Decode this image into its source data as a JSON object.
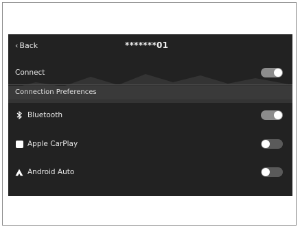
{
  "header": {
    "back_label": "Back",
    "title": "*******01"
  },
  "rows": {
    "connect": {
      "label": "Connect",
      "toggle": "on"
    },
    "section_header": "Connection Preferences",
    "bluetooth": {
      "label": "Bluetooth",
      "toggle": "on",
      "icon": "bluetooth-icon"
    },
    "carplay": {
      "label": "Apple CarPlay",
      "toggle": "off",
      "icon": "carplay-icon"
    },
    "android": {
      "label": "Android Auto",
      "toggle": "off",
      "icon": "android-auto-icon"
    }
  },
  "colors": {
    "screen_bg": "#222222",
    "section_bg": "#3a3a3a",
    "toggle_on": "#8c8c8c",
    "toggle_off": "#5a5a5a"
  }
}
